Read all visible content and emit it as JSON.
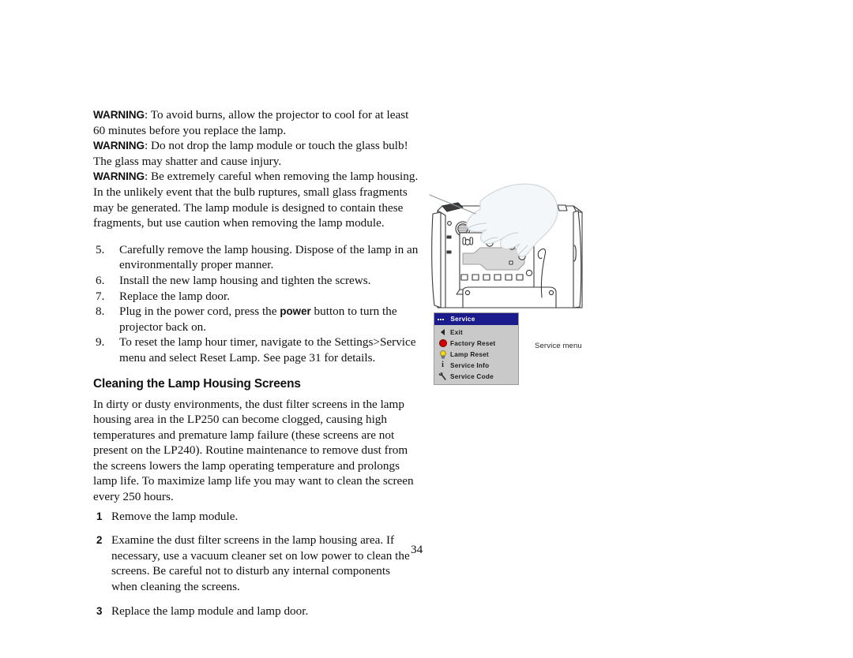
{
  "page": {
    "number": "34"
  },
  "warnings": [
    {
      "label": "WARNING",
      "text": ": To avoid burns, allow the projector to cool for at least 60 minutes before you replace the lamp."
    },
    {
      "label": "WARNING",
      "text": ": Do not drop the lamp module or touch the glass bulb! The glass may shatter and cause injury."
    },
    {
      "label": "WARNING",
      "text": ": Be extremely careful when removing the lamp housing. In the unlikely event that the bulb ruptures, small glass fragments may be generated. The lamp module is designed to contain these fragments, but use caution when removing the lamp module."
    }
  ],
  "procedure": [
    {
      "marker": "5.",
      "text": "Carefully remove the lamp housing. Dispose of the lamp in an environmentally proper manner."
    },
    {
      "marker": "6.",
      "text": "Install the new lamp housing and tighten the screws."
    },
    {
      "marker": "7.",
      "text": "Replace the lamp door."
    },
    {
      "marker": "8.",
      "text_before": "Plug in the power cord, press the ",
      "emphasis": "power",
      "text_after": " button to turn the projector back on."
    },
    {
      "marker": "9.",
      "text": "To reset the lamp hour timer, navigate to the Settings>Service menu and select Reset Lamp. See page 31 for details."
    }
  ],
  "section": {
    "heading": "Cleaning the Lamp Housing Screens",
    "body": "In dirty or dusty environments, the dust filter screens in the lamp housing area in the LP250 can become clogged, causing high temperatures and premature lamp failure (these screens are not present on the LP240). Routine maintenance to remove dust from the screens lowers the lamp operating temperature and prolongs lamp life. To maximize lamp life you may want to clean the screen every 250 hours."
  },
  "steps": [
    {
      "number": "1",
      "text": "Remove the lamp module."
    },
    {
      "number": "2",
      "text": "Examine the dust filter screens in the lamp housing area. If necessary, use a vacuum cleaner set on low power to clean the screens. Be careful not to disturb any internal components when cleaning the screens."
    },
    {
      "number": "3",
      "text": "Replace the lamp module and lamp door."
    }
  ],
  "osd_menu": {
    "title": "Service",
    "header_icon": "dots-icon",
    "header_color": "#1b1b8e",
    "body_color": "#c9c9c9",
    "items": [
      {
        "label": "Exit",
        "icon": "back-arrow-icon"
      },
      {
        "label": "Factory Reset",
        "icon": "red-circle-icon"
      },
      {
        "label": "Lamp Reset",
        "icon": "lamp-bulb-icon"
      },
      {
        "label": "Service Info",
        "icon": "info-icon"
      },
      {
        "label": "Service Code",
        "icon": "wrench-icon"
      }
    ]
  },
  "menu_caption": "Service menu",
  "illustration": {
    "name": "projector-lamp-removal-illustration"
  }
}
